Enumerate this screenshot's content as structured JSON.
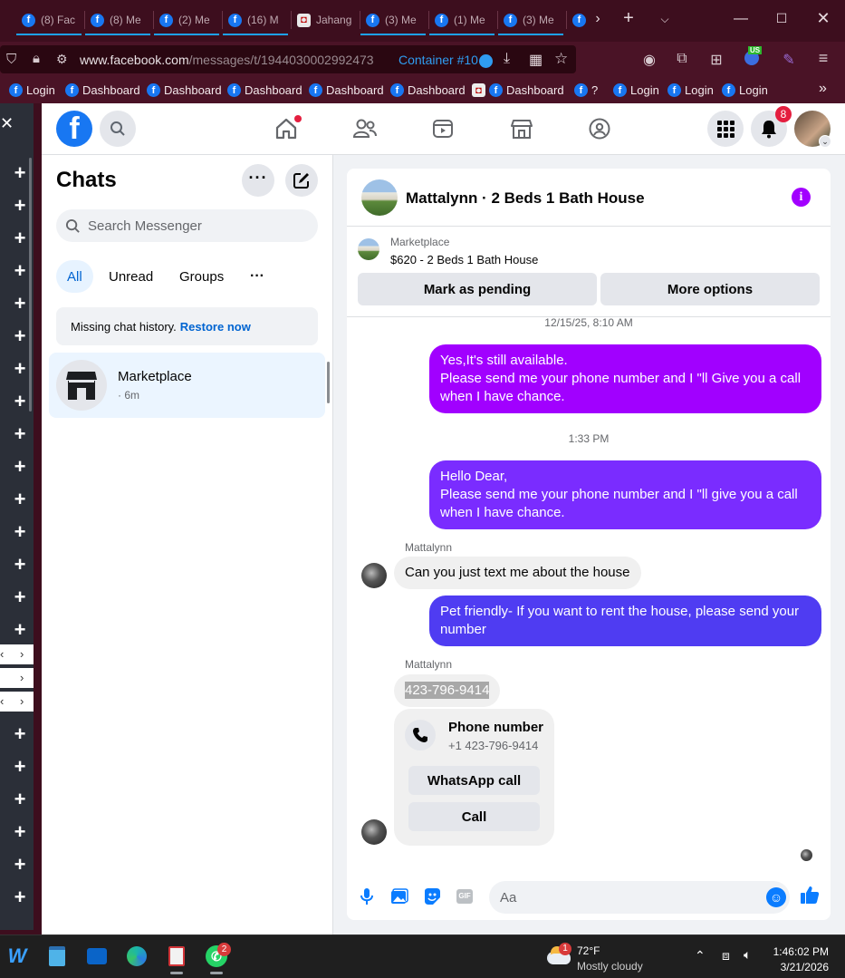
{
  "browser": {
    "tabs": [
      {
        "label": "(8) Fac",
        "icon": "facebook-icon"
      },
      {
        "label": "(8) Me",
        "icon": "facebook-icon"
      },
      {
        "label": "(2) Me",
        "icon": "facebook-icon"
      },
      {
        "label": "(16) M",
        "icon": "facebook-icon"
      },
      {
        "label": "Jahang",
        "icon": "site-icon"
      },
      {
        "label": "(3) Me",
        "icon": "facebook-icon"
      },
      {
        "label": "(1) Me",
        "icon": "facebook-icon"
      },
      {
        "label": "(3) Me",
        "icon": "facebook-icon"
      }
    ],
    "url_domain": "www.facebook.com",
    "url_path": "/messages/t/1944030002992473",
    "container_label": "Container #10",
    "bookmarks": [
      {
        "label": "Login",
        "icon": "facebook-icon"
      },
      {
        "label": "Dashboard",
        "icon": "facebook-icon"
      },
      {
        "label": "Dashboard",
        "icon": "facebook-icon"
      },
      {
        "label": "Dashboard",
        "icon": "facebook-icon"
      },
      {
        "label": "Dashboard",
        "icon": "facebook-icon"
      },
      {
        "label": "Dashboard",
        "icon": "facebook-icon"
      },
      {
        "label": "Dashboard",
        "icon": "site-icon"
      },
      {
        "label": "?",
        "icon": "facebook-icon"
      },
      {
        "label": "Login",
        "icon": "facebook-icon"
      },
      {
        "label": "Login",
        "icon": "facebook-icon"
      },
      {
        "label": "Login",
        "icon": "facebook-icon"
      }
    ],
    "extension_badge": "US"
  },
  "facebook": {
    "notification_count": "8",
    "chats_title": "Chats",
    "search_placeholder": "Search Messenger",
    "filters": [
      "All",
      "Unread",
      "Groups"
    ],
    "missing_history_text": "Missing chat history.",
    "restore_link": "Restore now",
    "chat_list": [
      {
        "name": "Marketplace",
        "time": "· 6m"
      }
    ]
  },
  "conversation": {
    "title": "Mattalynn · 2 Beds 1 Bath House",
    "marketplace_label": "Marketplace",
    "listing_title": "$620 - 2 Beds 1 Bath House",
    "mark_pending_label": "Mark as pending",
    "more_options_label": "More options",
    "messages": [
      {
        "type": "timestamp",
        "text": "12/15/25, 8:10 AM"
      },
      {
        "type": "outgoing",
        "text": "Yes,It's still available.\nPlease send me your phone number and I \"ll Give you a call when I have chance."
      },
      {
        "type": "timestamp",
        "text": "1:33 PM"
      },
      {
        "type": "outgoing",
        "text": "Hello Dear,\nPlease send me your phone number and I \"ll give you a call when I have chance."
      },
      {
        "type": "sender",
        "text": "Mattalynn"
      },
      {
        "type": "incoming",
        "text": "Can you just text me about the house"
      },
      {
        "type": "outgoing",
        "text": "Pet friendly- If you want to rent the house, please send your number"
      },
      {
        "type": "sender",
        "text": "Mattalynn"
      },
      {
        "type": "incoming",
        "text": "423-796-9414"
      }
    ],
    "phone_card": {
      "title": "Phone number",
      "number": "+1 423-796-9414",
      "whatsapp_label": "WhatsApp call",
      "call_label": "Call"
    },
    "composer_placeholder": "Aa"
  },
  "taskbar": {
    "whatsapp_badge": "2",
    "weather_badge": "1",
    "temperature": "72°F",
    "weather_text": "Mostly cloudy",
    "time": "1:46:02 PM",
    "date": "3/21/2026"
  },
  "colors": {
    "facebook_blue": "#1877f2",
    "bubble_purple": "#a100ff",
    "bubble_violet": "#7a2cff",
    "bubble_indigo": "#4f3cf2",
    "browser_bg": "#3d0e1e"
  }
}
